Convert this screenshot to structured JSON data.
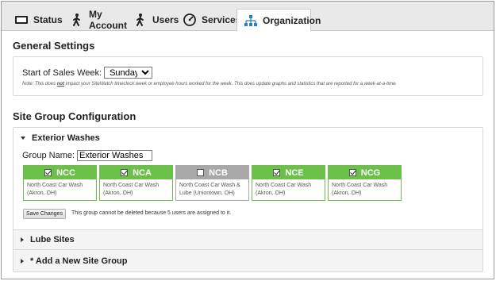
{
  "tabs": [
    {
      "label": "Status",
      "icon": "monitor-icon"
    },
    {
      "label": "My Account",
      "icon": "person-walking-icon"
    },
    {
      "label": "Users",
      "icon": "person-walking-icon"
    },
    {
      "label": "Services",
      "icon": "gauge-icon"
    },
    {
      "label": "Organization",
      "icon": "org-chart-icon"
    }
  ],
  "general": {
    "title": "General Settings",
    "sales_week_label": "Start of Sales Week:",
    "sales_week_value": "Sunday",
    "note_prefix": "Note: This does ",
    "note_emph": "not",
    "note_suffix": " impact your SiteWatch timeclock week or employee hours worked for the week. This does update graphs and statistics that are reported for a week-at-a-time."
  },
  "site_groups": {
    "title": "Site Group Configuration",
    "exterior": {
      "header": "Exterior Washes",
      "group_name_label": "Group Name:",
      "group_name_value": "Exterior Washes",
      "sites": [
        {
          "code": "NCC",
          "checked": true,
          "line1": "North Coast Car Wash",
          "line2": "(Akron, OH)"
        },
        {
          "code": "NCA",
          "checked": true,
          "line1": "North Coast Car Wash",
          "line2": "(Akron, OH)"
        },
        {
          "code": "NCB",
          "checked": false,
          "line1": "North Coast Car Wash &",
          "line2": "Lube (Uniontown, OH)"
        },
        {
          "code": "NCE",
          "checked": true,
          "line1": "North Coast Car Wash",
          "line2": "(Akron, OH)"
        },
        {
          "code": "NCG",
          "checked": true,
          "line1": "North Coast Car Wash",
          "line2": "(Akron, OH)"
        }
      ],
      "save_label": "Save Changes",
      "delete_message": "This group cannot be deleted because 5 users are assigned to it."
    },
    "lube": {
      "header": "Lube Sites"
    },
    "add_new": {
      "header": "* Add a New Site Group"
    }
  },
  "colors": {
    "accent_green": "#6cc04a",
    "disabled_gray": "#a8a8a8",
    "tab_bg": "#e9e9e9"
  }
}
